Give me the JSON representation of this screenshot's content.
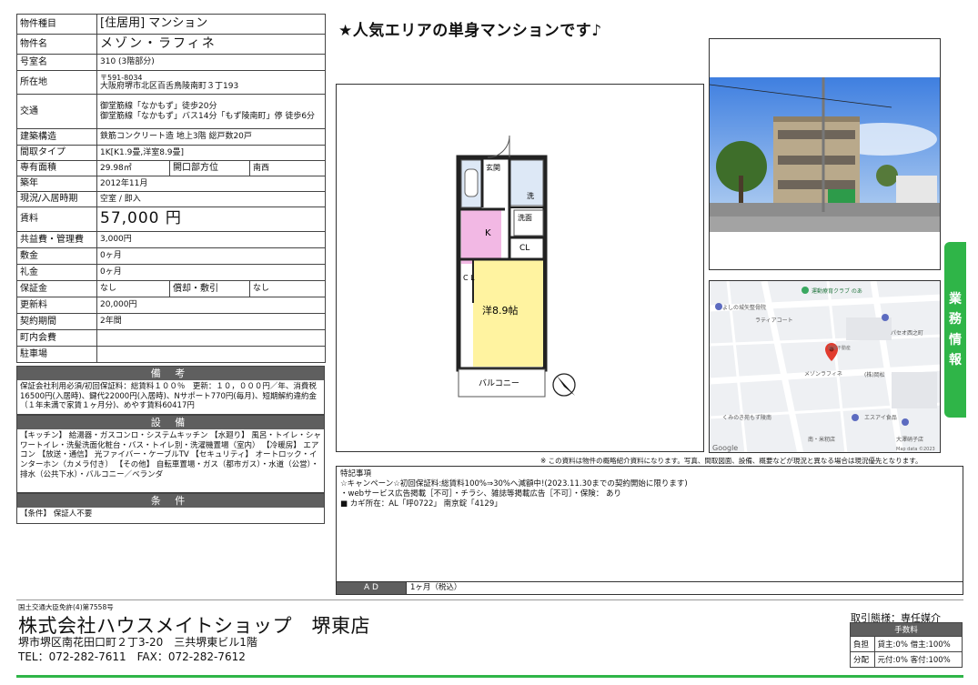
{
  "spec": {
    "property_type_label": "物件種目",
    "property_type": "[住居用] マンション",
    "name_label": "物件名",
    "name": "メゾン・ラフィネ",
    "room_label": "号室名",
    "room": "310 (3階部分)",
    "address_label": "所在地",
    "postal": "〒591-8034",
    "address": "大阪府堺市北区百舌鳥陵南町３丁193",
    "access_label": "交通",
    "access1": "御堂筋線「なかもず」徒歩20分",
    "access2": "御堂筋線「なかもず」バス14分「もず陵南町」停 徒歩6分",
    "structure_label": "建築構造",
    "structure": "鉄筋コンクリート造 地上3階 総戸数20戸",
    "layout_label": "間取タイプ",
    "layout": "1K[K1.9畳,洋室8.9畳]",
    "area_label": "専有面積",
    "area": "29.98㎡",
    "window_label": "開口部方位",
    "window": "南西",
    "built_label": "築年",
    "built": "2012年11月",
    "status_label": "現況/入居時期",
    "status": "空室 / 即入",
    "rent_label": "賃料",
    "rent": "57,000 円",
    "mgmt_label": "共益費・管理費",
    "mgmt": "3,000円",
    "deposit_label": "敷金",
    "deposit": "0ヶ月",
    "key_money_label": "礼金",
    "key_money": "0ヶ月",
    "guarantee_label": "保証金",
    "guarantee": "なし",
    "amort_label": "償却・敷引",
    "amort": "なし",
    "renewal_label": "更新料",
    "renewal": "20,000円",
    "period_label": "契約期間",
    "period": "2年間",
    "town_fee_label": "町内会費",
    "town_fee": "",
    "parking_label": "駐車場",
    "parking": ""
  },
  "remarks": {
    "header": "備 考",
    "body": "保証会社利用必須/初回保証料：総賃料１００％　更新：１０，０００円／年、消費税16500円(入居時)、鍵代22000円(入居時)、Nサポート770円(毎月)、短期解約違約金（１年未満で家賃１ヶ月分)、めやす賃料60417円"
  },
  "equipment": {
    "header": "設 備",
    "body": "【キッチン】 給湯器・ガスコンロ・システムキッチン 【水廻り】 風呂・トイレ・シャワートイレ・洗髪洗面化粧台・バス・トイレ別・洗濯機置場（室内） 【冷暖房】 エアコン 【放送・通信】 光ファイバー・ケーブルTV 【セキュリティ】 オートロック・インターホン（カメラ付き） 【その他】 自転車置場・ガス（都市ガス）・水道（公営）・排水（公共下水）・バルコニー／ベランダ"
  },
  "conditions": {
    "header": "条 件",
    "body": "【条件】 保証人不要"
  },
  "headline": "★人気エリアの単身マンションです♪",
  "floorplan": {
    "genkan": "玄関",
    "sentaku": "洗",
    "senmen": "洗面",
    "kitchen": "K",
    "cl1": "CL",
    "cl2": "C L",
    "room": "洋8.9帖",
    "balcony": "バルコニー"
  },
  "map": {
    "labels": [
      "運動療育クラブ のあ",
      "よしの城矢整骨院",
      "ラティアコート",
      "パセオ西之町",
      "関電不動産",
      "メゾンラフィネ",
      "(株)岡松",
      "くみのき苑もず陵南",
      "エスアイ食品",
      "大澤硝子店",
      "南・米籾店",
      "Google",
      "Map data ©2023"
    ]
  },
  "side_tab": [
    "業",
    "務",
    "情",
    "報"
  ],
  "note": "※ この資料は物件の概略紹介資料になります。写真、間取図面、設備、概要などが現況と異なる場合は現況優先となります。",
  "special": {
    "title": "特記事項",
    "line1": "☆キャンペーン☆初回保証料:総賃料100%⇒30%へ減額中!(2023.11.30までの契約開始に限ります)",
    "line2": "・webサービス広告掲載［不可］・チラシ、雑誌等掲載広告［不可］・保険： あり",
    "line3": "■ カギ所在：AL「呼0722」 南京錠「4129」",
    "ad_label": "A D",
    "ad_value": "1ヶ月（税込）"
  },
  "footer": {
    "license": "国土交通大臣免許(4)第7558号",
    "company": "株式会社ハウスメイトショップ　堺東店",
    "address": "堺市堺区南花田口町２丁3-20　三共堺東ビル1階",
    "tel": "TEL：072-282-7611　FAX：072-282-7612",
    "deal": "取引態様：専任媒介",
    "fee_header": "手数料",
    "fee_burden_label": "負担",
    "fee_burden": "貸主:0% 借主:100%",
    "fee_split_label": "分配",
    "fee_split": "元付:0% 客付:100%"
  }
}
